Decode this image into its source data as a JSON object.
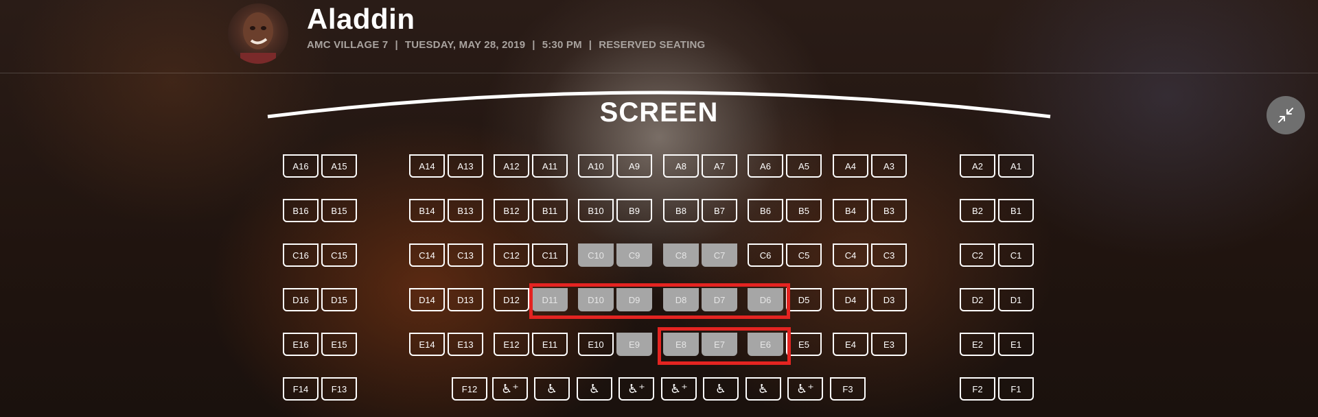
{
  "header": {
    "title": "Aladdin",
    "theater": "AMC VILLAGE 7",
    "date": "TUESDAY, MAY 28, 2019",
    "time": "5:30 PM",
    "seating": "RESERVED SEATING",
    "separator": "|"
  },
  "screen": {
    "label": "SCREEN"
  },
  "icons": {
    "collapse": "collapse-arrows-icon",
    "wheelchair": "wheelchair-icon"
  },
  "colors": {
    "taken": "#a6a6a6",
    "highlight": "#e42421"
  },
  "rows": [
    {
      "row": "A",
      "seats": [
        {
          "label": "A16",
          "taken": false
        },
        {
          "label": "A15",
          "taken": false
        },
        {
          "label": "A14",
          "taken": false
        },
        {
          "label": "A13",
          "taken": false
        },
        {
          "label": "A12",
          "taken": false
        },
        {
          "label": "A11",
          "taken": false
        },
        {
          "label": "A10",
          "taken": false
        },
        {
          "label": "A9",
          "taken": false
        },
        {
          "label": "A8",
          "taken": false
        },
        {
          "label": "A7",
          "taken": false
        },
        {
          "label": "A6",
          "taken": false
        },
        {
          "label": "A5",
          "taken": false
        },
        {
          "label": "A4",
          "taken": false
        },
        {
          "label": "A3",
          "taken": false
        },
        {
          "label": "A2",
          "taken": false
        },
        {
          "label": "A1",
          "taken": false
        }
      ]
    },
    {
      "row": "B",
      "seats": [
        {
          "label": "B16",
          "taken": false
        },
        {
          "label": "B15",
          "taken": false
        },
        {
          "label": "B14",
          "taken": false
        },
        {
          "label": "B13",
          "taken": false
        },
        {
          "label": "B12",
          "taken": false
        },
        {
          "label": "B11",
          "taken": false
        },
        {
          "label": "B10",
          "taken": false
        },
        {
          "label": "B9",
          "taken": false
        },
        {
          "label": "B8",
          "taken": false
        },
        {
          "label": "B7",
          "taken": false
        },
        {
          "label": "B6",
          "taken": false
        },
        {
          "label": "B5",
          "taken": false
        },
        {
          "label": "B4",
          "taken": false
        },
        {
          "label": "B3",
          "taken": false
        },
        {
          "label": "B2",
          "taken": false
        },
        {
          "label": "B1",
          "taken": false
        }
      ]
    },
    {
      "row": "C",
      "seats": [
        {
          "label": "C16",
          "taken": false
        },
        {
          "label": "C15",
          "taken": false
        },
        {
          "label": "C14",
          "taken": false
        },
        {
          "label": "C13",
          "taken": false
        },
        {
          "label": "C12",
          "taken": false
        },
        {
          "label": "C11",
          "taken": false
        },
        {
          "label": "C10",
          "taken": true
        },
        {
          "label": "C9",
          "taken": true
        },
        {
          "label": "C8",
          "taken": true
        },
        {
          "label": "C7",
          "taken": true
        },
        {
          "label": "C6",
          "taken": false
        },
        {
          "label": "C5",
          "taken": false
        },
        {
          "label": "C4",
          "taken": false
        },
        {
          "label": "C3",
          "taken": false
        },
        {
          "label": "C2",
          "taken": false
        },
        {
          "label": "C1",
          "taken": false
        }
      ]
    },
    {
      "row": "D",
      "seats": [
        {
          "label": "D16",
          "taken": false
        },
        {
          "label": "D15",
          "taken": false
        },
        {
          "label": "D14",
          "taken": false
        },
        {
          "label": "D13",
          "taken": false
        },
        {
          "label": "D12",
          "taken": false
        },
        {
          "label": "D11",
          "taken": true
        },
        {
          "label": "D10",
          "taken": true
        },
        {
          "label": "D9",
          "taken": true
        },
        {
          "label": "D8",
          "taken": true
        },
        {
          "label": "D7",
          "taken": true
        },
        {
          "label": "D6",
          "taken": true
        },
        {
          "label": "D5",
          "taken": false
        },
        {
          "label": "D4",
          "taken": false
        },
        {
          "label": "D3",
          "taken": false
        },
        {
          "label": "D2",
          "taken": false
        },
        {
          "label": "D1",
          "taken": false
        }
      ]
    },
    {
      "row": "E",
      "seats": [
        {
          "label": "E16",
          "taken": false
        },
        {
          "label": "E15",
          "taken": false
        },
        {
          "label": "E14",
          "taken": false
        },
        {
          "label": "E13",
          "taken": false
        },
        {
          "label": "E12",
          "taken": false
        },
        {
          "label": "E11",
          "taken": false
        },
        {
          "label": "E10",
          "taken": false
        },
        {
          "label": "E9",
          "taken": true
        },
        {
          "label": "E8",
          "taken": true
        },
        {
          "label": "E7",
          "taken": true
        },
        {
          "label": "E6",
          "taken": true
        },
        {
          "label": "E5",
          "taken": false
        },
        {
          "label": "E4",
          "taken": false
        },
        {
          "label": "E3",
          "taken": false
        },
        {
          "label": "E2",
          "taken": false
        },
        {
          "label": "E1",
          "taken": false
        }
      ]
    },
    {
      "row": "F",
      "seats": [
        {
          "label": "F14",
          "taken": false
        },
        {
          "label": "F13",
          "taken": false
        },
        {
          "label": "F12",
          "taken": false
        },
        {
          "label": "",
          "wheelchair": true,
          "companion": true
        },
        {
          "label": "",
          "wheelchair": true
        },
        {
          "label": "",
          "wheelchair": true
        },
        {
          "label": "",
          "wheelchair": true,
          "companion": true
        },
        {
          "label": "",
          "wheelchair": true,
          "companion": true
        },
        {
          "label": "",
          "wheelchair": true
        },
        {
          "label": "",
          "wheelchair": true
        },
        {
          "label": "",
          "wheelchair": true,
          "companion": true
        },
        {
          "label": "F3",
          "taken": false
        },
        {
          "label": "F2",
          "taken": false
        },
        {
          "label": "F1",
          "taken": false
        }
      ]
    }
  ]
}
